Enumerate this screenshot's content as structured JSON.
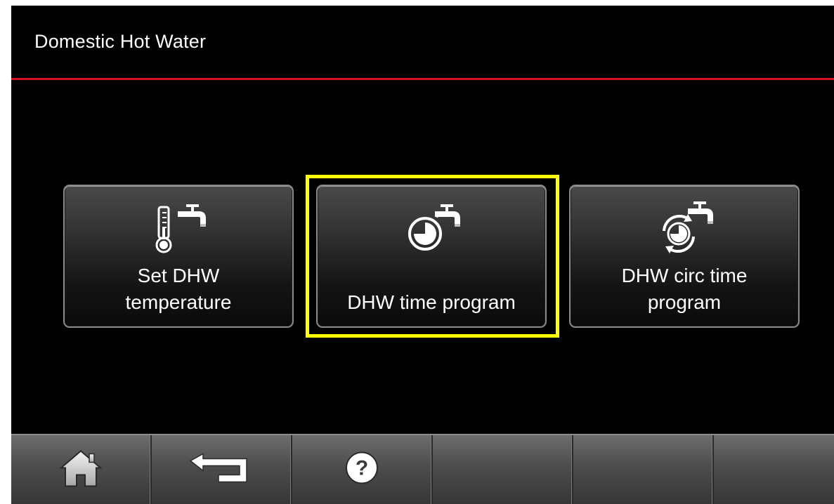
{
  "header": {
    "title": "Domestic Hot Water"
  },
  "tiles": [
    {
      "line1": "Set DHW",
      "line2": "temperature",
      "icon": "thermometer-tap-icon"
    },
    {
      "line1": "DHW time program",
      "line2": "",
      "icon": "clock-tap-icon"
    },
    {
      "line1": "DHW circ time",
      "line2": "program",
      "icon": "circulation-clock-tap-icon"
    }
  ],
  "footer": {
    "buttons": [
      {
        "icon": "home-icon"
      },
      {
        "icon": "back-arrow-icon"
      },
      {
        "icon": "help-icon"
      },
      {
        "icon": ""
      },
      {
        "icon": ""
      },
      {
        "icon": ""
      }
    ]
  },
  "colors": {
    "background": "#000000",
    "accent_rule": "#d4121e",
    "selection_highlight": "#ffff00",
    "text": "#ffffff"
  },
  "selected_tile_index": 1
}
